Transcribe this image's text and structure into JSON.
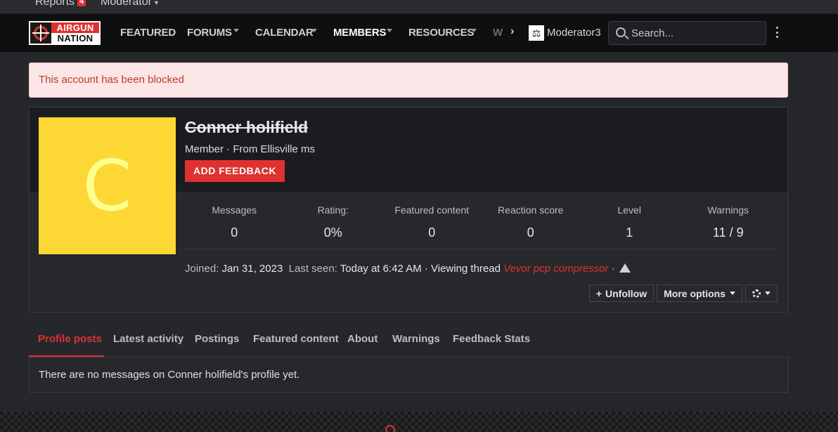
{
  "top_strip": {
    "reports_label": "Reports",
    "reports_count": "4",
    "moderator_label": "Moderator"
  },
  "logo": {
    "line1": "AIRGUN",
    "line2": "NATION"
  },
  "nav": {
    "items": [
      {
        "label": "FEATURED"
      },
      {
        "label": "FORUMS"
      },
      {
        "label": "CALENDAR"
      },
      {
        "label": "MEMBERS"
      },
      {
        "label": "RESOURCES"
      },
      {
        "label": "W"
      }
    ],
    "active": "MEMBERS",
    "user": "Moderator3",
    "search_placeholder": "Search..."
  },
  "alert": {
    "text": "This account has been blocked"
  },
  "profile": {
    "avatar_letter": "C",
    "avatar_color": "#fdd835",
    "name": "Conner holifield",
    "meta": "Member · From Ellisville ms",
    "feedback_button": "ADD FEEDBACK",
    "stats": [
      {
        "label": "Messages",
        "value": "0"
      },
      {
        "label": "Rating:",
        "value": "0%"
      },
      {
        "label": "Featured content",
        "value": "0"
      },
      {
        "label": "Reaction score",
        "value": "0"
      },
      {
        "label": "Level",
        "value": "1"
      },
      {
        "label": "Warnings",
        "value": "11 / 9"
      }
    ],
    "joined_label": "Joined:",
    "joined_value": "Jan 31, 2023",
    "last_seen_label": "Last seen:",
    "last_seen_value": "Today at 6:42 AM · Viewing thread",
    "thread_link": "Vevor pcp compressor",
    "separator": "·",
    "unfollow_button": "Unfollow",
    "more_options_button": "More options"
  },
  "tabs": [
    {
      "label": "Profile posts"
    },
    {
      "label": "Latest activity"
    },
    {
      "label": "Postings"
    },
    {
      "label": "Featured content"
    },
    {
      "label": "About"
    },
    {
      "label": "Warnings"
    },
    {
      "label": "Feedback Stats"
    }
  ],
  "posts_panel": {
    "empty_message": "There are no messages on Conner holifield's profile yet."
  },
  "colors": {
    "accent": "#e03131",
    "background": "#26272b",
    "nav_background": "#0f0f10"
  }
}
